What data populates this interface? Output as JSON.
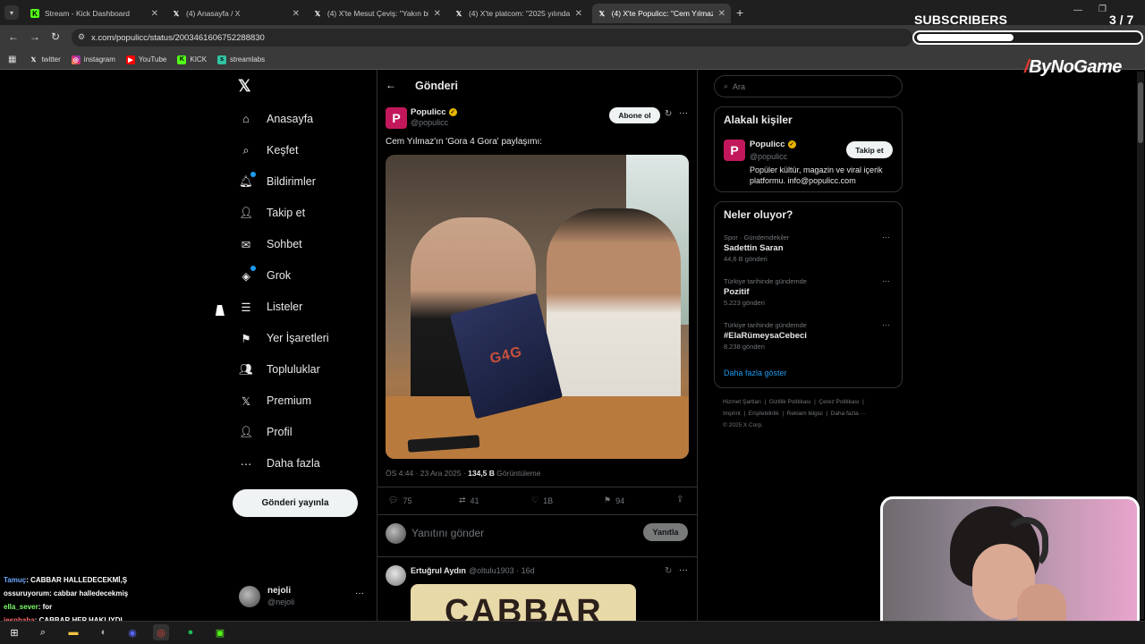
{
  "browser": {
    "tabs": [
      {
        "label": "Stream - Kick Dashboard",
        "favicon": "kick-icon",
        "active": false
      },
      {
        "label": "(4) Anasayfa / X",
        "favicon": "x-icon",
        "active": false
      },
      {
        "label": "(4) X'te Mesut Çeviş: \"Yakın bi",
        "favicon": "x-icon",
        "active": false
      },
      {
        "label": "(4) X'te platcom: \"2025 yılında",
        "favicon": "x-icon",
        "active": false
      },
      {
        "label": "(4) X'te Populicc: \"Cem Yılmaz'",
        "favicon": "x-icon",
        "active": true
      }
    ],
    "url": "x.com/populicc/status/2003461606752288830",
    "bookmarks": [
      "twitter",
      "instagram",
      "YouTube",
      "KICK",
      "streamlabs"
    ]
  },
  "overlay": {
    "subscribers_label": "SUBSCRIBERS",
    "subscribers_count": "3 / 7",
    "subscribers_progress": 0.43,
    "logo": "ByNoGame"
  },
  "x_nav": {
    "items": [
      "Anasayfa",
      "Keşfet",
      "Bildirimler",
      "Takip et",
      "Sohbet",
      "Grok",
      "Listeler",
      "Yer İşaretleri",
      "Topluluklar",
      "Premium",
      "Profil",
      "Daha fazla"
    ],
    "post_button": "Gönderi yayınla",
    "account": {
      "name": "nejoli",
      "handle": "@nejoli"
    }
  },
  "post": {
    "header": "Gönderi",
    "author_name": "Populicc",
    "author_handle": "@populicc",
    "subscribe_label": "Abone ol",
    "text": "Cem Yılmaz'ın 'Gora 4 Gora' paylaşımı:",
    "photo_text": "G4G",
    "time": "ÖS 4:44 · 23 Ara 2025 · ",
    "views": "134,5 B",
    "views_label": " Görüntüleme",
    "replies": "75",
    "reposts": "41",
    "likes": "1B",
    "bookmarks": "94",
    "reply_placeholder": "Yanıtını gönder",
    "reply_button": "Yanıtla"
  },
  "reply": {
    "author_name": "Ertuğrul Aydın",
    "author_handle": "@oltulu1903 · 16d",
    "image_text": "CABBAR"
  },
  "right": {
    "search_placeholder": "Ara",
    "related_title": "Alakalı kişiler",
    "related": {
      "name": "Populicc",
      "handle": "@populicc",
      "follow": "Takip et",
      "bio": "Popüler kültür, magazin ve viral içerik platformu. info@populicc.com"
    },
    "trends_title": "Neler oluyor?",
    "trends": [
      {
        "context": "Spor · Gündemdekiler",
        "name": "Sadettin Saran",
        "count": "44,6 B gönderi"
      },
      {
        "context": "Türkiye tarihinde gündemde",
        "name": "Pozitif",
        "count": "5.223 gönderi"
      },
      {
        "context": "Türkiye tarihinde gündemde",
        "name": "#ElaRümeysaCebeci",
        "count": "8.238 gönderi"
      }
    ],
    "show_more": "Daha fazla göster",
    "footer_line1": "Hizmet Şartları  |  Gizlilik Politikası  |  Çerez Politikası  |",
    "footer_line2": "Imprint  |  Erişilebilirlik  |  Reklam bilgisi  |  Daha fazla ···",
    "footer_line3": "© 2025 X Corp."
  },
  "chat": [
    {
      "user": "Tamuç",
      "msg": ": CABBAR HALLEDECEKMİ,Ş",
      "color": "#6fa8ff"
    },
    {
      "user": "ossuruyorum",
      "msg": ": cabbar halledecekmiş",
      "color": "#ffffff"
    },
    {
      "user": "ella_sever",
      "msg": ": for",
      "color": "#7cff6a"
    },
    {
      "user": "jesnbaba",
      "msg": ": CABBAR HEP HAKLIYDI..",
      "color": "#ff6a6a"
    }
  ]
}
